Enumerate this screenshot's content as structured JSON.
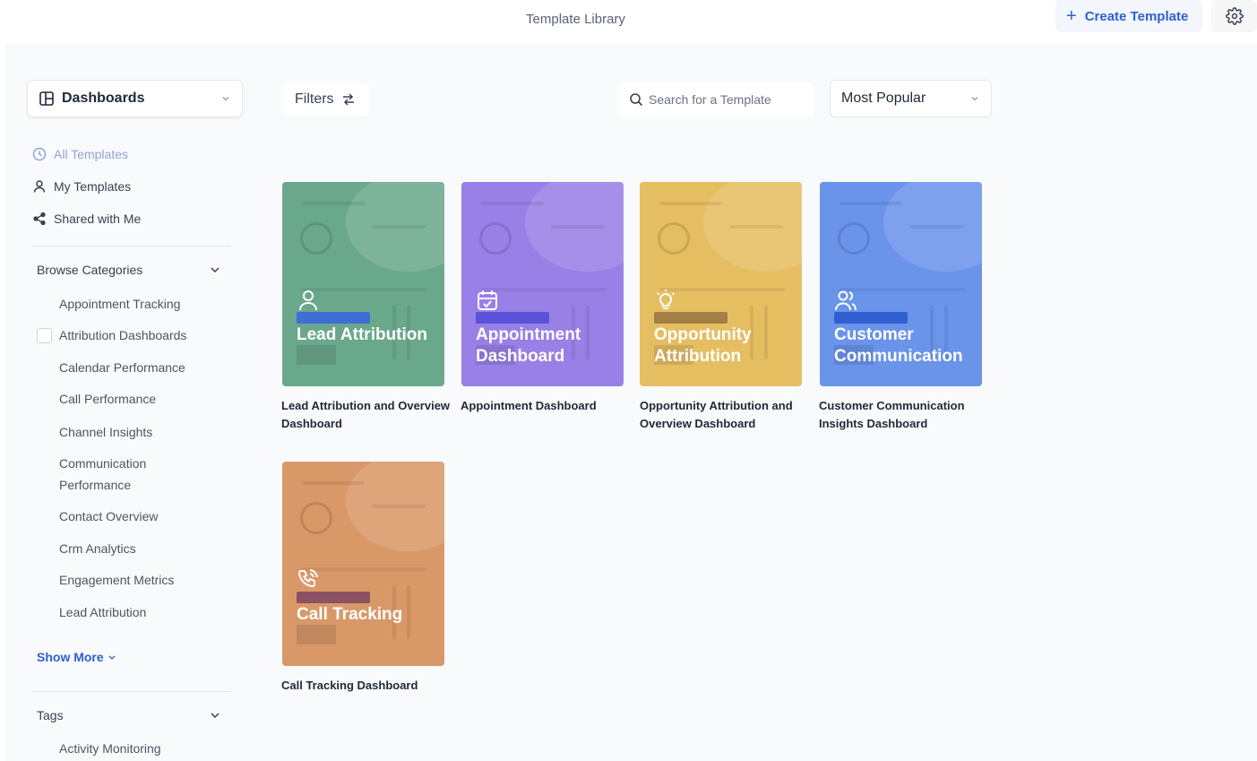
{
  "header": {
    "title": "Template Library",
    "create_label": "Create Template",
    "settings_icon": "gear-icon"
  },
  "toolbar": {
    "dashboard_select": "Dashboards",
    "filters_label": "Filters",
    "search_placeholder": "Search for a Template",
    "sort_select": "Most Popular"
  },
  "sidebar": {
    "nav": [
      {
        "label": "All Templates",
        "icon": "clock-icon",
        "active": true
      },
      {
        "label": "My Templates",
        "icon": "user-icon",
        "active": false
      },
      {
        "label": "Shared with Me",
        "icon": "share-icon",
        "active": false
      }
    ],
    "browse_categories": {
      "heading": "Browse Categories",
      "items": [
        "Appointment Tracking",
        "Attribution Dashboards",
        "Calendar Performance",
        "Call Performance",
        "Channel Insights",
        "Communication Performance",
        "Contact Overview",
        "Crm Analytics",
        "Engagement Metrics",
        "Lead Attribution"
      ],
      "show_more": "Show More"
    },
    "tags": {
      "heading": "Tags",
      "items": [
        "Activity Monitoring"
      ]
    }
  },
  "cards": [
    {
      "title": "Lead Attribution",
      "label": "Lead Attribution and Overview Dashboard",
      "color": "#6aa88c",
      "highlight": "#3f6ed6",
      "icon": "user-icon"
    },
    {
      "title": "Appointment Dashboard",
      "label": "Appointment Dashboard",
      "color": "#9880e6",
      "highlight": "#5a52d8",
      "icon": "calendar-icon"
    },
    {
      "title": "Opportunity Attribution",
      "label": "Opportunity Attribution and Overview Dashboard",
      "color": "#e6be62",
      "highlight": "#a17f45",
      "icon": "lightbulb-icon"
    },
    {
      "title": "Customer Communication",
      "label": "Customer Communication Insights Dashboard",
      "color": "#6a93ea",
      "highlight": "#2f5fd0",
      "icon": "users-icon"
    },
    {
      "title": "Call Tracking",
      "label": "Call Tracking Dashboard",
      "color": "#d99868",
      "highlight": "#8a5263",
      "icon": "phone-icon"
    }
  ]
}
